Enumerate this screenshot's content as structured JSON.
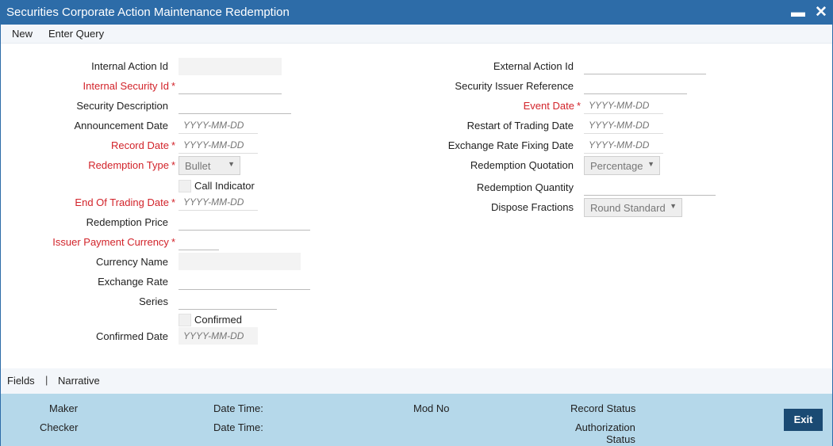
{
  "window": {
    "title": "Securities Corporate Action Maintenance Redemption",
    "minimize_glyph": "▬",
    "close_glyph": "✕"
  },
  "menu": {
    "new": "New",
    "enter_query": "Enter Query"
  },
  "left": {
    "internal_action_id": {
      "label": "Internal Action Id",
      "value": ""
    },
    "internal_security_id": {
      "label": "Internal Security Id",
      "value": ""
    },
    "security_description": {
      "label": "Security Description",
      "value": ""
    },
    "announcement_date": {
      "label": "Announcement Date",
      "placeholder": "YYYY-MM-DD"
    },
    "record_date": {
      "label": "Record Date",
      "placeholder": "YYYY-MM-DD"
    },
    "redemption_type": {
      "label": "Redemption Type",
      "value": "Bullet"
    },
    "call_indicator": {
      "label": "Call Indicator",
      "checked": false
    },
    "end_of_trading_date": {
      "label": "End Of Trading Date",
      "placeholder": "YYYY-MM-DD"
    },
    "redemption_price": {
      "label": "Redemption Price",
      "value": ""
    },
    "issuer_payment_currency": {
      "label": "Issuer Payment Currency",
      "value": ""
    },
    "currency_name": {
      "label": "Currency Name",
      "value": ""
    },
    "exchange_rate": {
      "label": "Exchange Rate",
      "value": ""
    },
    "series": {
      "label": "Series",
      "value": ""
    },
    "confirmed": {
      "label": "Confirmed",
      "checked": false
    },
    "confirmed_date": {
      "label": "Confirmed Date",
      "placeholder": "YYYY-MM-DD"
    }
  },
  "right": {
    "external_action_id": {
      "label": "External Action Id",
      "value": ""
    },
    "security_issuer_reference": {
      "label": "Security Issuer Reference",
      "value": ""
    },
    "event_date": {
      "label": "Event Date",
      "placeholder": "YYYY-MM-DD"
    },
    "restart_of_trading_date": {
      "label": "Restart of Trading Date",
      "placeholder": "YYYY-MM-DD"
    },
    "exchange_rate_fixing_date": {
      "label": "Exchange Rate Fixing Date",
      "placeholder": "YYYY-MM-DD"
    },
    "redemption_quotation": {
      "label": "Redemption Quotation",
      "value": "Percentage"
    },
    "redemption_quantity": {
      "label": "Redemption Quantity",
      "value": ""
    },
    "dispose_fractions": {
      "label": "Dispose Fractions",
      "value": "Round Standard"
    }
  },
  "required_mark": "*",
  "subbar": {
    "fields": "Fields",
    "separator": "|",
    "narrative": "Narrative"
  },
  "footer": {
    "maker": "Maker",
    "date_time_1": "Date Time:",
    "mod_no": "Mod No",
    "record_status": "Record Status",
    "checker": "Checker",
    "date_time_2": "Date Time:",
    "authorization_status_line1": "Authorization",
    "authorization_status_line2": "Status",
    "exit": "Exit"
  },
  "colors": {
    "title_bar": "#2d6ca8",
    "required_label": "#d2232a",
    "footer_bg": "#b5d8ea",
    "exit_button": "#1a4a73"
  }
}
